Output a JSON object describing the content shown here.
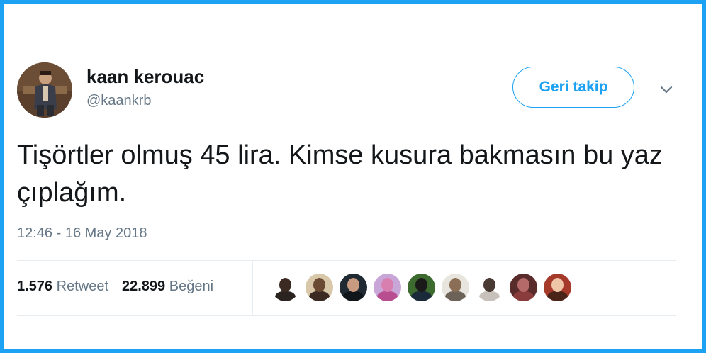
{
  "user": {
    "name": "kaan kerouac",
    "handle": "@kaankrb"
  },
  "actions": {
    "follow_label": "Geri takip",
    "menu_icon": "chevron-down-icon"
  },
  "tweet": {
    "text": "Tişörtler olmuş 45 lira. Kimse kusura bakmasın bu yaz çıplağım.",
    "timestamp": "12:46 - 16 May 2018"
  },
  "stats": {
    "retweets_count": "1.576",
    "retweets_label": "Retweet",
    "likes_count": "22.899",
    "likes_label": "Beğeni"
  },
  "colors": {
    "accent": "#1da1f2",
    "text": "#14171a",
    "muted": "#657786",
    "divider": "#e6ecf0"
  },
  "likers": [
    {
      "bg": "#ffffff",
      "head": "#3b2a22",
      "body": "#2a2320"
    },
    {
      "bg": "#d8c7a8",
      "head": "#6b4a33",
      "body": "#3a2a22"
    },
    {
      "bg": "#1f2a33",
      "head": "#c89a80",
      "body": "#11161b"
    },
    {
      "bg": "#c9a6d8",
      "head": "#d97fb0",
      "body": "#b84d8f"
    },
    {
      "bg": "#3d6b2f",
      "head": "#1a1a1a",
      "body": "#1a2a3a"
    },
    {
      "bg": "#e8e4de",
      "head": "#8a6e56",
      "body": "#6d6258"
    },
    {
      "bg": "#ffffff",
      "head": "#4a3a34",
      "body": "#c7c0bb"
    },
    {
      "bg": "#5a2b2b",
      "head": "#b56a6a",
      "body": "#8a3b3b"
    },
    {
      "bg": "#a53a2a",
      "head": "#f0c6a8",
      "body": "#4a2418"
    }
  ]
}
